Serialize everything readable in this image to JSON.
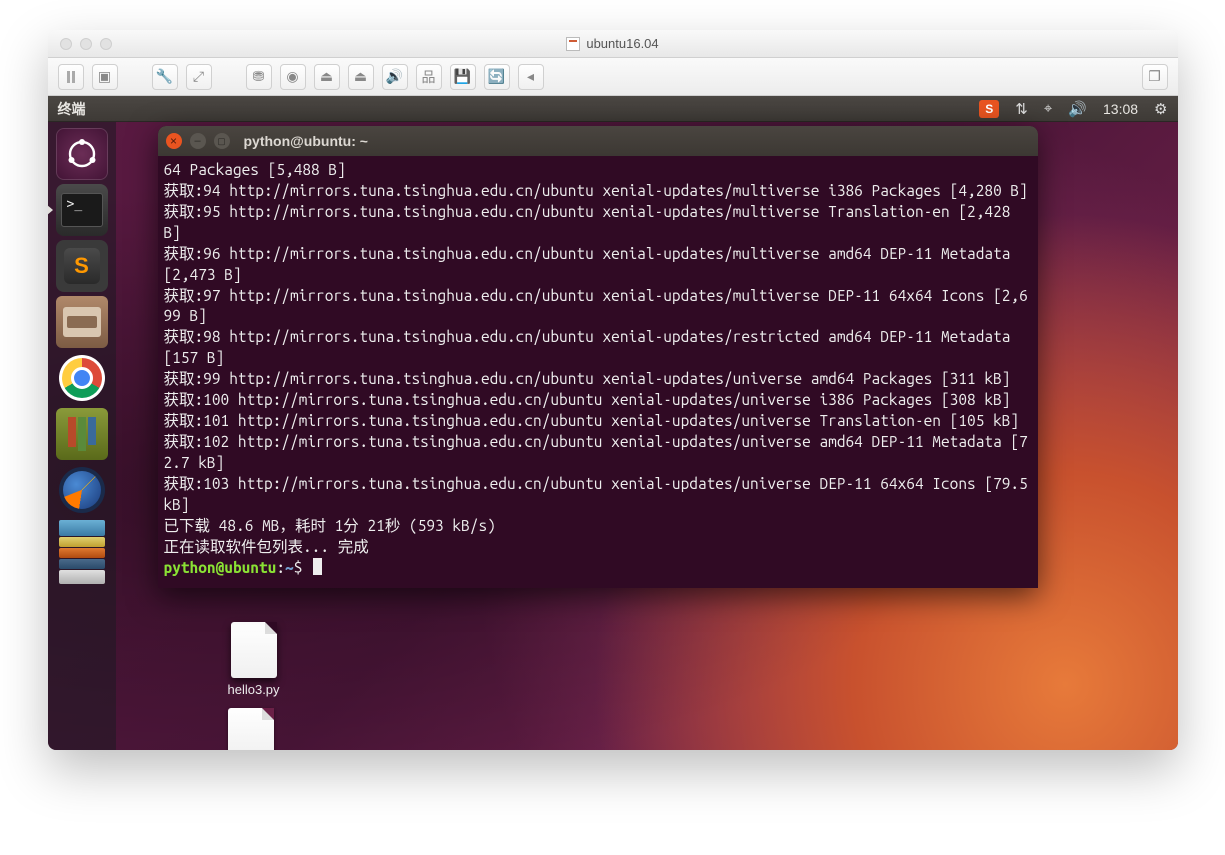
{
  "host": {
    "title": "ubuntu16.04",
    "toolbar_icons": [
      "pause",
      "snapshot",
      "wrench",
      "resize",
      "hdd",
      "cd",
      "usb1",
      "usb2",
      "sound",
      "net",
      "floppy",
      "sync",
      "chevron-left"
    ]
  },
  "menubar": {
    "title": "终端",
    "ime": "S",
    "clock": "13:08"
  },
  "launcher": {
    "items": [
      "dash",
      "terminal",
      "sublime",
      "files",
      "chrome",
      "books",
      "firefox",
      "stack"
    ]
  },
  "terminal": {
    "title": "python@ubuntu: ~",
    "lines": [
      "64 Packages [5,488 B]",
      "获取:94 http://mirrors.tuna.tsinghua.edu.cn/ubuntu xenial-updates/multiverse i386 Packages [4,280 B]",
      "获取:95 http://mirrors.tuna.tsinghua.edu.cn/ubuntu xenial-updates/multiverse Translation-en [2,428 B]",
      "获取:96 http://mirrors.tuna.tsinghua.edu.cn/ubuntu xenial-updates/multiverse amd64 DEP-11 Metadata [2,473 B]",
      "获取:97 http://mirrors.tuna.tsinghua.edu.cn/ubuntu xenial-updates/multiverse DEP-11 64x64 Icons [2,699 B]",
      "获取:98 http://mirrors.tuna.tsinghua.edu.cn/ubuntu xenial-updates/restricted amd64 DEP-11 Metadata [157 B]",
      "获取:99 http://mirrors.tuna.tsinghua.edu.cn/ubuntu xenial-updates/universe amd64 Packages [311 kB]",
      "获取:100 http://mirrors.tuna.tsinghua.edu.cn/ubuntu xenial-updates/universe i386 Packages [308 kB]",
      "获取:101 http://mirrors.tuna.tsinghua.edu.cn/ubuntu xenial-updates/universe Translation-en [105 kB]",
      "获取:102 http://mirrors.tuna.tsinghua.edu.cn/ubuntu xenial-updates/universe amd64 DEP-11 Metadata [72.7 kB]",
      "获取:103 http://mirrors.tuna.tsinghua.edu.cn/ubuntu xenial-updates/universe DEP-11 64x64 Icons [79.5 kB]",
      "已下载 48.6 MB，耗时 1分 21秒 (593 kB/s)",
      "正在读取软件包列表... 完成"
    ],
    "prompt_user": "python@ubuntu",
    "prompt_sep": ":",
    "prompt_path": "~",
    "prompt_dollar": "$"
  },
  "desktop": {
    "file1": "hello3.py"
  }
}
